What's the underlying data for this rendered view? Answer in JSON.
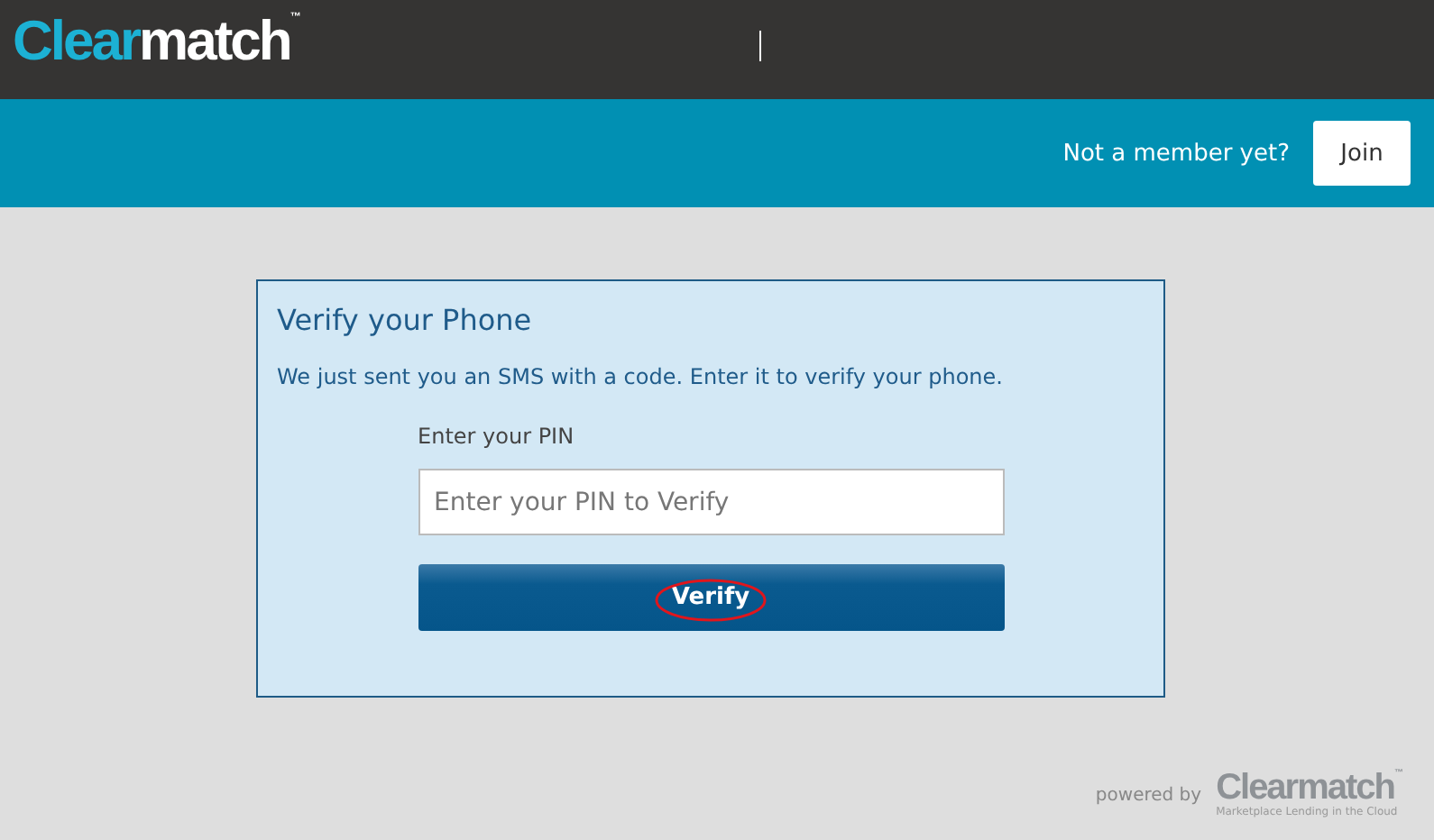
{
  "header": {
    "logo": {
      "part_1": "Clear",
      "part_2": "match",
      "mark": "™"
    }
  },
  "nav_bar": {
    "prompt": "Not a member yet?",
    "join_button": "Join"
  },
  "card": {
    "title": "Verify your Phone",
    "message": "We just sent you an SMS with a code. Enter it to verify your phone.",
    "pin_label": "Enter your PIN",
    "pin_field": {
      "placeholder": "Enter your PIN to Verify"
    },
    "verify_button": {
      "label": "Verify",
      "circled": true
    }
  },
  "footer": {
    "powered_by": "powered by",
    "logo": {
      "part_1": "Clearmatch",
      "mark": "™"
    },
    "tagline": "Marketplace Lending in the Cloud"
  }
}
